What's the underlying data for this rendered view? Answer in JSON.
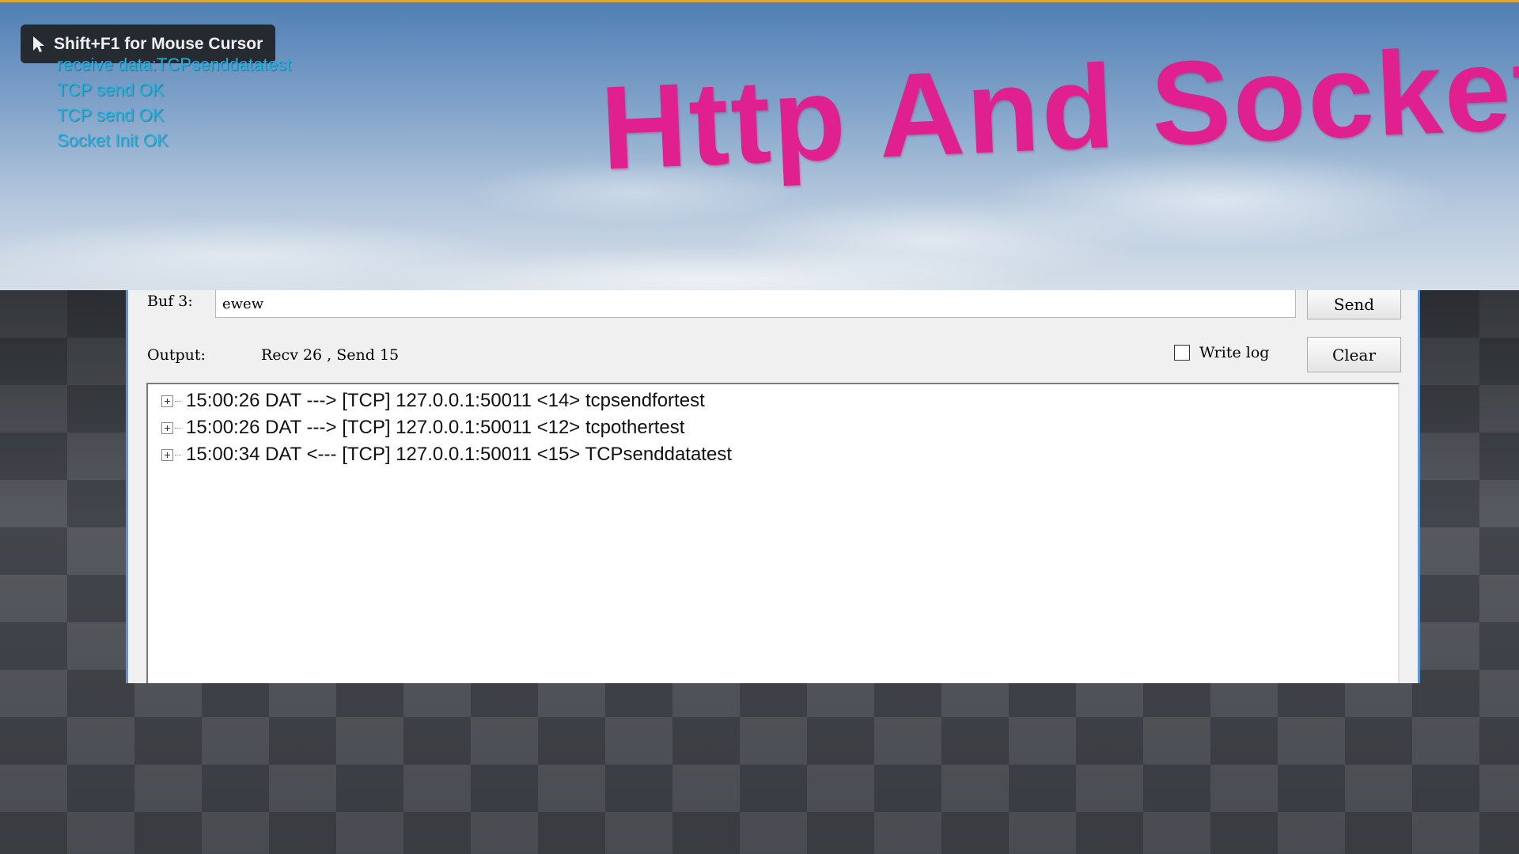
{
  "overlay": {
    "cursor_hint": "Shift+F1 for Mouse Cursor",
    "log_lines": [
      "receive data:TCPsenddatatest",
      "TCP send OK",
      "TCP send OK",
      "Socket Init OK"
    ],
    "title_3d": "Http And Socket"
  },
  "dialog": {
    "buf_label": "Buf 3:",
    "buf_value": "ewew",
    "send_label": "Send",
    "output_label": "Output:",
    "stats": "Recv 26 , Send 15",
    "write_log_label": "Write log",
    "write_log_checked": false,
    "clear_label": "Clear",
    "entries": [
      "15:00:26 DAT ---> [TCP] 127.0.0.1:50011 <14> tcpsendfortest",
      "15:00:26 DAT ---> [TCP] 127.0.0.1:50011 <12> tcpothertest",
      "15:00:34 DAT <--- [TCP] 127.0.0.1:50011 <15> TCPsenddatatest"
    ]
  },
  "colors": {
    "title": "#e0208f",
    "log_text": "#19b6e6",
    "dialog_border": "#5b96d4",
    "top_accent": "#d8a63a"
  }
}
